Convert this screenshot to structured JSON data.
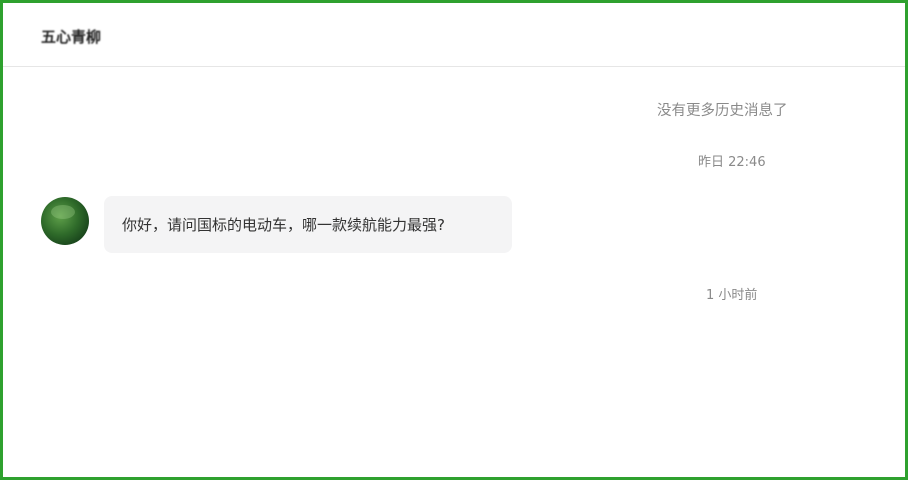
{
  "header": {
    "contact_name": "五心青柳"
  },
  "chat": {
    "no_more_history": "没有更多历史消息了",
    "timestamp_1": "昨日 22:46",
    "timestamp_2": "1 小时前",
    "messages": [
      {
        "text": "你好，请问国标的电动车，哪一款续航能力最强?"
      }
    ]
  },
  "colors": {
    "frame_border": "#2ea12e",
    "bubble_background": "#f4f4f5",
    "system_text": "#8a8a8a"
  }
}
